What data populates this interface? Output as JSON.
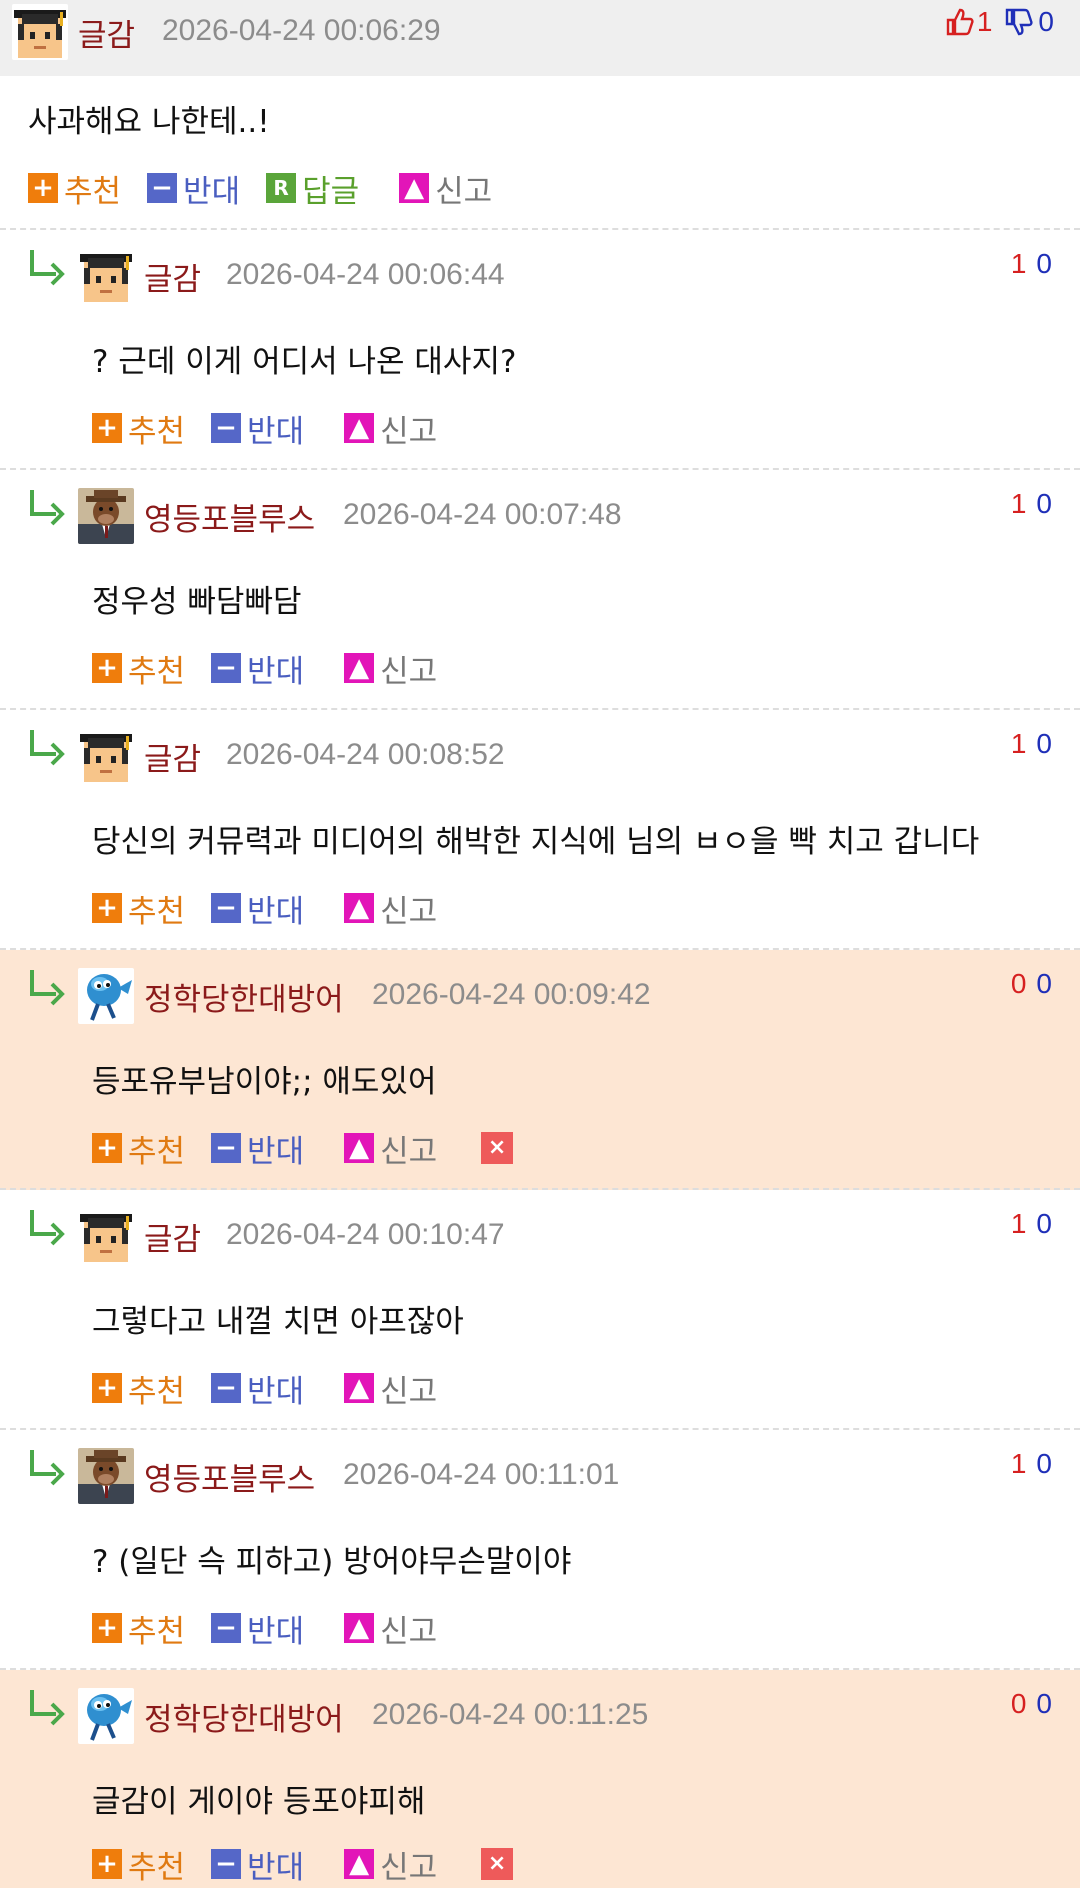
{
  "actions": {
    "recommend": "추천",
    "oppose": "반대",
    "reply": "답글",
    "report": "신고"
  },
  "icons": {
    "recommend": "plus-icon",
    "oppose": "minus-icon",
    "reply": "reply-r-icon",
    "report": "siren-icon",
    "delete": "close-icon",
    "reply_arrow": "reply-arrow-icon",
    "top_up": "thumbs-up-icon",
    "top_down": "thumbs-down-icon"
  },
  "colors": {
    "author": "#8b1a1a",
    "up": "#d62020",
    "down": "#1f2fb8",
    "highlight_bg": "#fde6d3",
    "recommend": "#ef7d0c",
    "oppose": "#5567c8",
    "reply": "#5aa53a",
    "report": "#e215b8",
    "delete": "#ee5a5a"
  },
  "comments": [
    {
      "author": "글감",
      "time": "2026-04-24 00:06:29",
      "up": "1",
      "down": "0",
      "body": "사과해요 나한테..!",
      "avatar": "graduate-avatar"
    },
    {
      "author": "글감",
      "time": "2026-04-24 00:06:44",
      "up": "1",
      "down": "0",
      "body": "? 근데 이게 어디서 나온 대사지?",
      "avatar": "graduate-avatar"
    },
    {
      "author": "영등포블루스",
      "time": "2026-04-24 00:07:48",
      "up": "1",
      "down": "0",
      "body": "정우성 빠담빠담",
      "avatar": "bull-suit-avatar"
    },
    {
      "author": "글감",
      "time": "2026-04-24 00:08:52",
      "up": "1",
      "down": "0",
      "body": "당신의 커뮤력과 미디어의 해박한 지식에 님의 ㅂㅇ을 빡 치고 갑니다",
      "avatar": "graduate-avatar"
    },
    {
      "author": "정학당한대방어",
      "time": "2026-04-24 00:09:42",
      "up": "0",
      "down": "0",
      "body": "등포유부남이야;; 애도있어",
      "avatar": "blue-fish-avatar"
    },
    {
      "author": "글감",
      "time": "2026-04-24 00:10:47",
      "up": "1",
      "down": "0",
      "body": "그렇다고 내껄 치면 아프잖아",
      "avatar": "graduate-avatar"
    },
    {
      "author": "영등포블루스",
      "time": "2026-04-24 00:11:01",
      "up": "1",
      "down": "0",
      "body": "? (일단 슥 피하고) 방어야무슨말이야",
      "avatar": "bull-suit-avatar"
    },
    {
      "author": "정학당한대방어",
      "time": "2026-04-24 00:11:25",
      "up": "0",
      "down": "0",
      "body": "글감이 게이야 등포야피해",
      "avatar": "blue-fish-avatar"
    }
  ]
}
